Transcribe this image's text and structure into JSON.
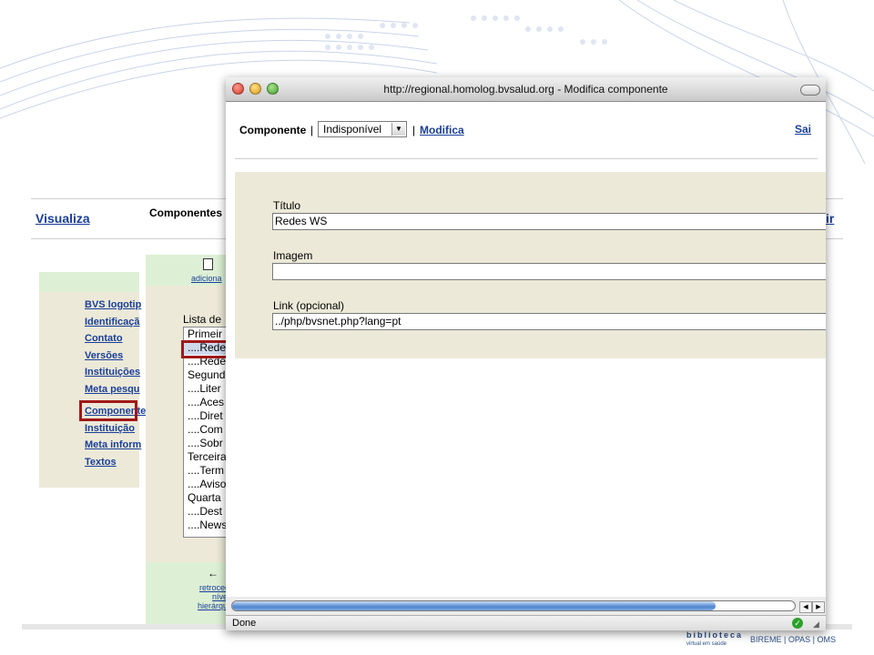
{
  "background_page": {
    "nav_visualiza": "Visualiza",
    "nav_sair_fragment": "ir",
    "left_menu": [
      "BVS logotip",
      "Identificaçã",
      "Contato",
      "Versões",
      "Instituições",
      "Meta pesqu",
      "Componente",
      "Instituição",
      "Meta inform",
      "Textos"
    ],
    "components_title": "Componentes",
    "add_link": "adiciona",
    "list_label": "Lista de",
    "component_list": [
      "Primeir",
      "....Rede",
      "....Rede",
      "Segund",
      "....Liter",
      "....Aces",
      "....Diret",
      "....Com",
      "....Sobr",
      "Terceira",
      "....Term",
      "....Aviso",
      "Quarta",
      "....Dest",
      "....News"
    ],
    "back_arrow": "←",
    "back_link_lines": [
      "retroced",
      "nível",
      "hierárqui"
    ],
    "footer": {
      "logo_text": "biblioteca",
      "logo_subtext": "virtual em saúde",
      "orgs": "BIREME | OPAS | OMS"
    }
  },
  "popup": {
    "window_title": "http://regional.homolog.bvsalud.org - Modifica componente",
    "component_label": "Componente",
    "separator": "|",
    "status_select_value": "Indisponível",
    "modifica_link": "Modifica",
    "sair_link": "Sai",
    "form": {
      "titulo_label": "Título",
      "titulo_value": "Redes WS",
      "imagem_label": "Imagem",
      "imagem_value": "",
      "link_label": "Link (opcional)",
      "link_value": "../php/bvsnet.php?lang=pt"
    },
    "progress_fraction": 0.86,
    "status_text": "Done"
  },
  "colors": {
    "link_blue": "#1a3f99",
    "panel_beige": "#ece9d8",
    "panel_green": "#ddf0d5",
    "highlight_red": "#a01818"
  }
}
